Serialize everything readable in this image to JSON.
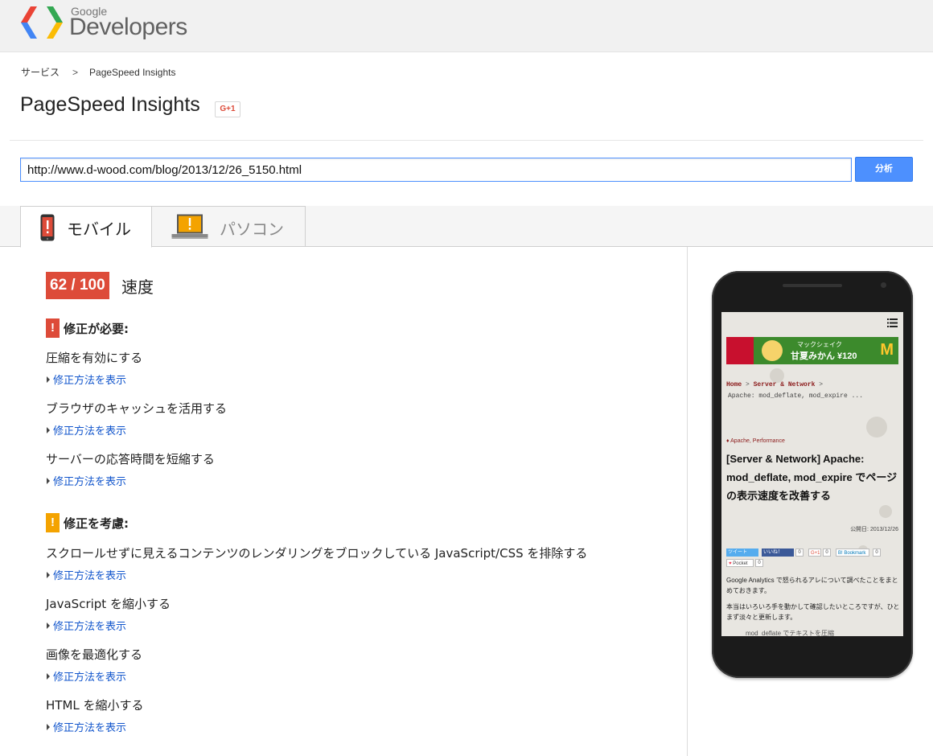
{
  "header": {
    "brand_small": "Google",
    "brand_large": "Developers",
    "colors": {
      "bar": "#f1f1f1",
      "accent": "#4d90fe"
    }
  },
  "breadcrumb": {
    "items": [
      "サービス",
      "PageSpeed Insights"
    ],
    "separator": ">"
  },
  "page": {
    "title": "PageSpeed Insights",
    "gplus_label": "G+1"
  },
  "form": {
    "url_value": "http://www.d-wood.com/blog/2013/12/26_5150.html",
    "analyze_label": "分析"
  },
  "tabs": [
    {
      "label": "モバイル",
      "icon": "mobile-warning-icon",
      "selected": true
    },
    {
      "label": "パソコン",
      "icon": "desktop-warning-icon",
      "selected": false
    }
  ],
  "result": {
    "score_text": "62 / 100",
    "score": 62,
    "score_max": 100,
    "score_color": "#dd4b39",
    "category_label": "速度",
    "sections": [
      {
        "badge": "!",
        "badge_color": "#dd4b39",
        "title": "修正が必要:",
        "rules": [
          {
            "name": "圧縮を有効にする",
            "link": "修正方法を表示"
          },
          {
            "name": "ブラウザのキャッシュを活用する",
            "link": "修正方法を表示"
          },
          {
            "name": "サーバーの応答時間を短縮する",
            "link": "修正方法を表示"
          }
        ]
      },
      {
        "badge": "!",
        "badge_color": "#f4a300",
        "title": "修正を考慮:",
        "rules": [
          {
            "name": "スクロールせずに見えるコンテンツのレンダリングをブロックしている JavaScript/CSS を排除する",
            "link": "修正方法を表示"
          },
          {
            "name": "JavaScript を縮小する",
            "link": "修正方法を表示"
          },
          {
            "name": "画像を最適化する",
            "link": "修正方法を表示"
          },
          {
            "name": "HTML を縮小する",
            "link": "修正方法を表示"
          }
        ]
      }
    ]
  },
  "preview": {
    "banner_text1": "マックシェイク",
    "banner_text2": "甘夏みかん ¥120",
    "banner_brand_mark": "M",
    "crumb_home": "Home",
    "crumb_sep": " > ",
    "crumb_cat": "Server & Network",
    "crumb_page": "Apache: mod_deflate, mod_expire ...",
    "tags": "Apache, Performance",
    "title": "[Server & Network] Apache: mod_deflate, mod_expire でページの表示速度を改善する",
    "date": "公開日: 2013/12/26",
    "social": {
      "tweet": "ツイート",
      "like": "いいね！",
      "like_count": "0",
      "gplus": "G+1",
      "gplus_count": "0",
      "hatena": "B! Bookmark",
      "hatena_count": "0",
      "pocket": "Pocket",
      "pocket_count": "0"
    },
    "p1": "Google Analytics で怒られるアレについて調べたことをまとめておきます。",
    "p2": "本当はいろいろ手を動かして確認したいところですが、ひとまず淡々と更新します。",
    "p3": "mod_deflate でテキストを圧縮"
  }
}
